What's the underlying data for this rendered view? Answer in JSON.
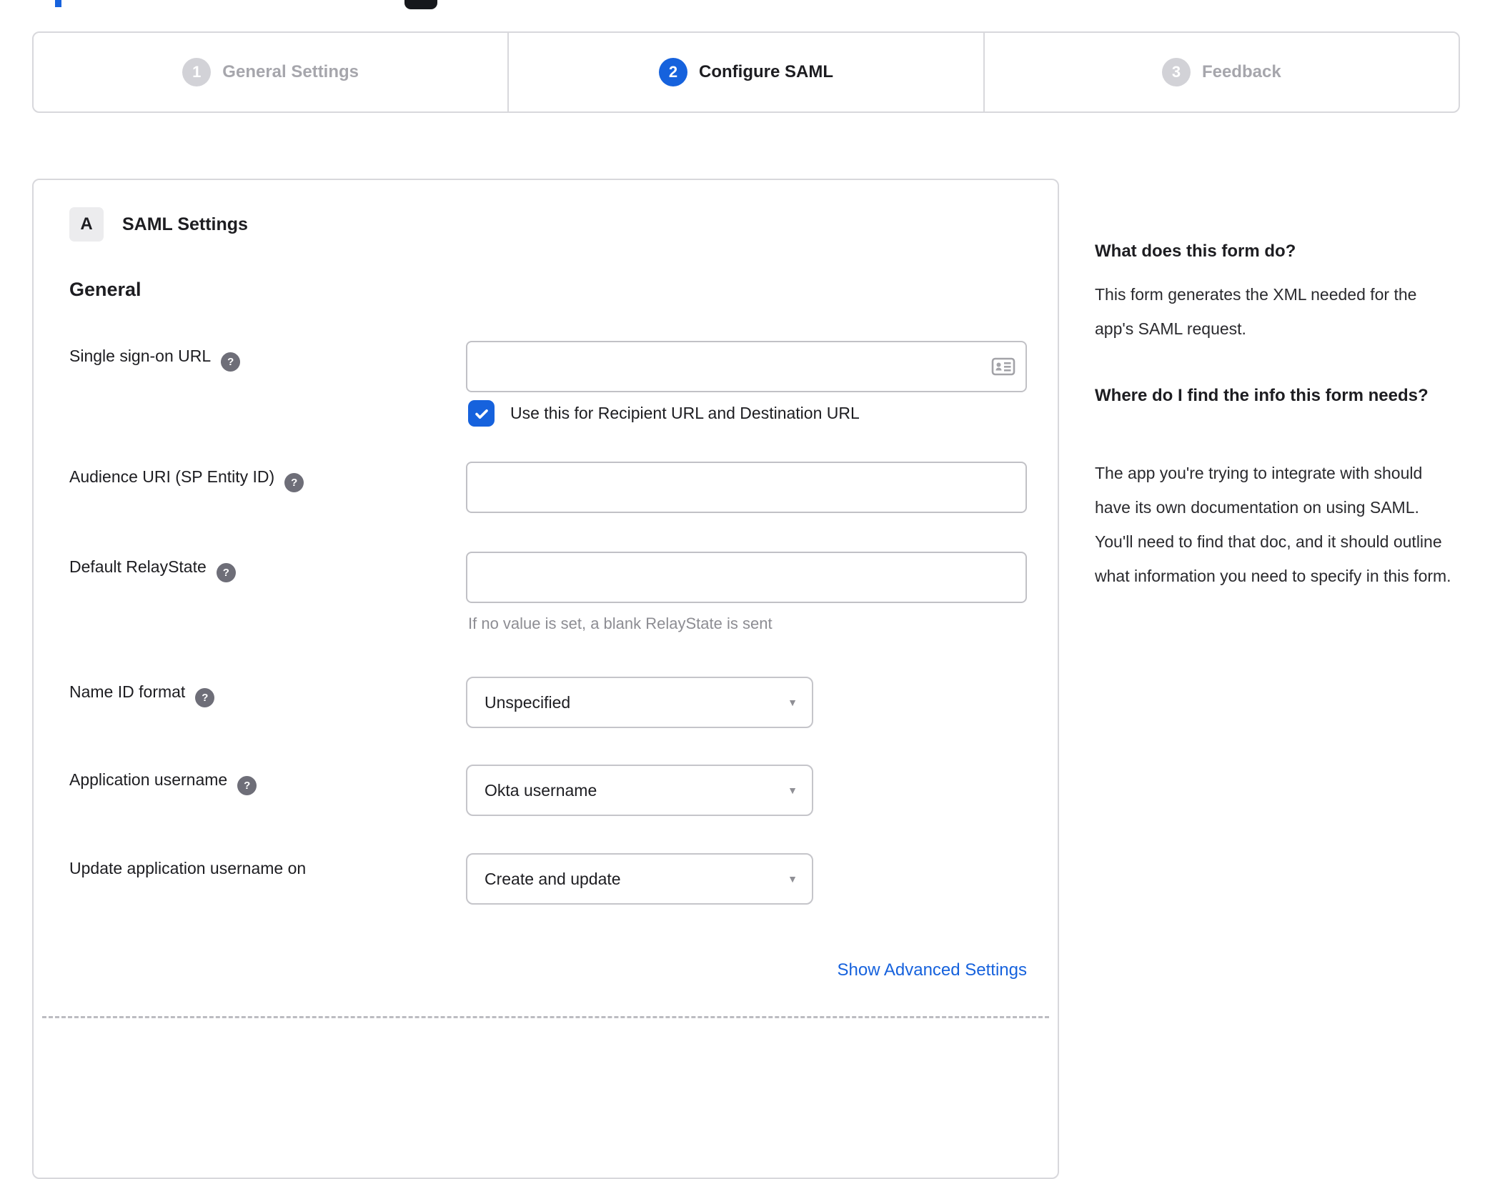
{
  "stepper": {
    "steps": [
      {
        "number": "1",
        "label": "General Settings",
        "state": "inactive"
      },
      {
        "number": "2",
        "label": "Configure SAML",
        "state": "active"
      },
      {
        "number": "3",
        "label": "Feedback",
        "state": "inactive"
      }
    ]
  },
  "panel": {
    "section_badge": "A",
    "section_title": "SAML Settings",
    "group_title": "General",
    "fields": [
      {
        "label": "Single sign-on URL",
        "value": "",
        "checkbox": {
          "checked": true,
          "label": "Use this for Recipient URL and Destination URL"
        }
      },
      {
        "label": "Audience URI (SP Entity ID)",
        "value": ""
      },
      {
        "label": "Default RelayState",
        "value": "",
        "hint": "If no value is set, a blank RelayState is sent"
      },
      {
        "label": "Name ID format",
        "value": "Unspecified"
      },
      {
        "label": "Application username",
        "value": "Okta username"
      },
      {
        "label": "Update application username on",
        "value": "Create and update"
      }
    ],
    "advanced_link": "Show Advanced Settings"
  },
  "help": {
    "question_1": "What does this form do?",
    "answer_1": "This form generates the XML needed for the app's SAML request.",
    "question_2": "Where do I find the info this form needs?",
    "answer_2": "The app you're trying to integrate with should have its own documentation on using SAML. You'll need to find that doc, and it should outline what information you need to specify in this form."
  },
  "icons": {
    "help_glyph": "?",
    "caret_glyph": "▼"
  },
  "colors": {
    "accent_blue": "#1662dd",
    "inactive_gray": "#d2d2d7",
    "border_gray": "#d8d8dc"
  }
}
